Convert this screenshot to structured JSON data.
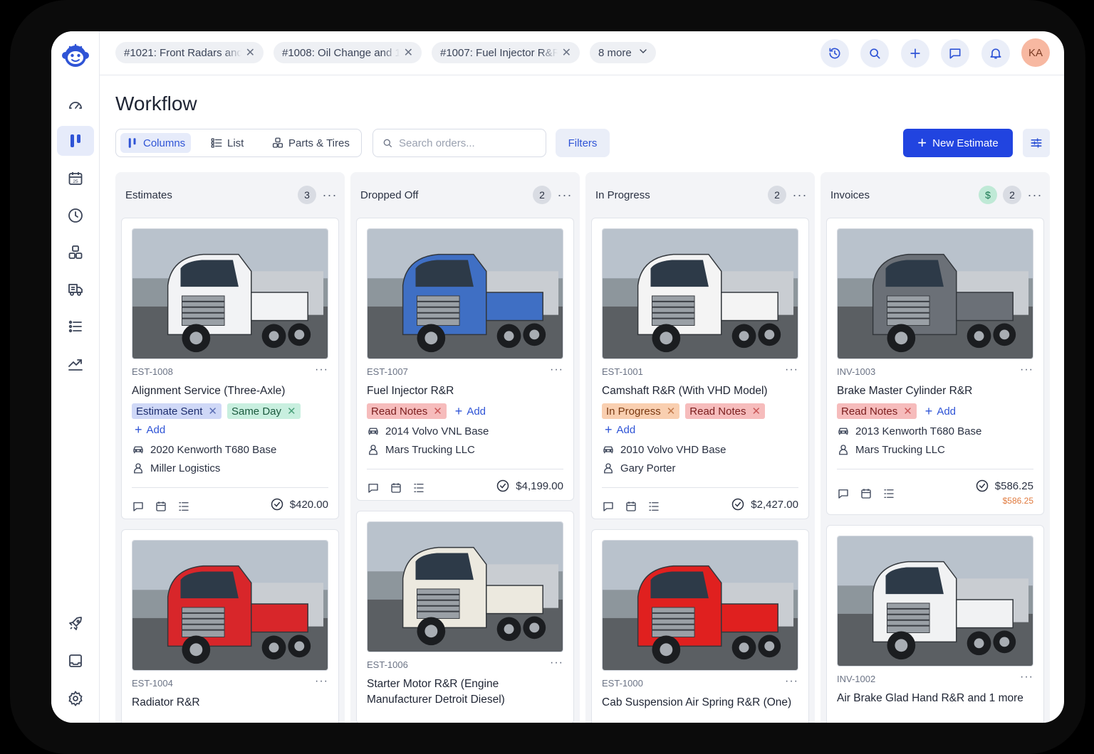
{
  "colors": {
    "accent": "#2144e0",
    "sidebar_active": "#e6ebfa"
  },
  "tabs": [
    {
      "label": "#1021: Front Radars and"
    },
    {
      "label": "#1008: Oil Change and 1"
    },
    {
      "label": "#1007: Fuel Injector R&R"
    }
  ],
  "more_tabs": "8 more",
  "user": {
    "initials": "KA"
  },
  "page": {
    "title": "Workflow"
  },
  "views": {
    "columns": "Columns",
    "list": "List",
    "parts": "Parts & Tires"
  },
  "search": {
    "placeholder": "Search orders..."
  },
  "filters_label": "Filters",
  "new_estimate_label": "New Estimate",
  "columns": [
    {
      "title": "Estimates",
      "count": "3",
      "cards": [
        {
          "id": "EST-1008",
          "title": "Alignment Service (Three-Axle)",
          "tags": [
            {
              "label": "Estimate Sent",
              "color": "blue"
            },
            {
              "label": "Same Day",
              "color": "green"
            }
          ],
          "add": "Add",
          "vehicle": "2020 Kenworth T680 Base",
          "customer": "Miller Logistics",
          "amount": "$420.00",
          "truck_color": "#f2f3f5"
        },
        {
          "id": "EST-1004",
          "title": "Radiator R&R",
          "truck_color": "#d8262a"
        }
      ]
    },
    {
      "title": "Dropped Off",
      "count": "2",
      "cards": [
        {
          "id": "EST-1007",
          "title": "Fuel Injector R&R",
          "tags": [
            {
              "label": "Read Notes",
              "color": "red"
            }
          ],
          "add": "Add",
          "vehicle": "2014 Volvo VNL Base",
          "customer": "Mars Trucking LLC",
          "amount": "$4,199.00",
          "truck_color": "#3f6fc4"
        },
        {
          "id": "EST-1006",
          "title": "Starter Motor R&R (Engine Manufacturer Detroit Diesel)",
          "truck_color": "#ece9df"
        }
      ]
    },
    {
      "title": "In Progress",
      "count": "2",
      "cards": [
        {
          "id": "EST-1001",
          "title": "Camshaft R&R (With VHD Model)",
          "tags": [
            {
              "label": "In Progress",
              "color": "orange"
            },
            {
              "label": "Read Notes",
              "color": "red"
            }
          ],
          "add": "Add",
          "vehicle": "2010 Volvo VHD Base",
          "customer": "Gary Porter",
          "amount": "$2,427.00",
          "truck_color": "#f4f4f4"
        },
        {
          "id": "EST-1000",
          "title": "Cab Suspension Air Spring R&R (One)",
          "truck_color": "#e0201f"
        }
      ]
    },
    {
      "title": "Invoices",
      "count": "2",
      "badge": "$",
      "cards": [
        {
          "id": "INV-1003",
          "title": "Brake Master Cylinder R&R",
          "tags": [
            {
              "label": "Read Notes",
              "color": "red"
            }
          ],
          "add": "Add",
          "vehicle": "2013 Kenworth T680 Base",
          "customer": "Mars Trucking LLC",
          "amount": "$586.25",
          "due": "$586.25",
          "truck_color": "#6b7077"
        },
        {
          "id": "INV-1002",
          "title": "Air Brake Glad Hand R&R and 1 more",
          "truck_color": "#f1f2f3"
        }
      ]
    }
  ],
  "icons": {
    "close": "close-icon",
    "search": "search-icon",
    "history": "history-icon",
    "plus": "plus-icon",
    "chat": "chat-icon",
    "bell": "bell-icon"
  }
}
